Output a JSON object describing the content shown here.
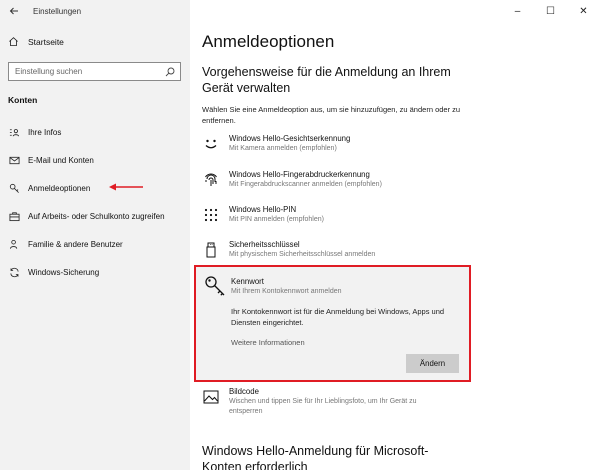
{
  "window": {
    "app_title": "Einstellungen",
    "back_icon": "back-arrow-icon",
    "controls": [
      "–",
      "☐",
      "✕"
    ]
  },
  "sidebar": {
    "home_label": "Startseite",
    "search_placeholder": "Einstellung suchen",
    "section_label": "Konten",
    "items": [
      {
        "label": "Ihre Infos",
        "icon": "person-card-icon"
      },
      {
        "label": "E-Mail und Konten",
        "icon": "mail-icon"
      },
      {
        "label": "Anmeldeoptionen",
        "icon": "key-icon",
        "selected": true
      },
      {
        "label": "Auf Arbeits- oder Schulkonto zugreifen",
        "icon": "briefcase-icon"
      },
      {
        "label": "Familie & andere Benutzer",
        "icon": "people-icon"
      },
      {
        "label": "Windows-Sicherung",
        "icon": "sync-icon"
      }
    ],
    "annotation_arrow_color": "#e01c24"
  },
  "main": {
    "title": "Anmeldeoptionen",
    "subtitle": "Vorgehensweise für die Anmeldung an Ihrem Gerät verwalten",
    "intro": "Wählen Sie eine Anmeldeoption aus, um sie hinzuzufügen, zu ändern oder zu entfernen.",
    "options": [
      {
        "title": "Windows Hello-Gesichtserkennung",
        "desc": "Mit Kamera anmelden (empfohlen)",
        "icon": "face-icon"
      },
      {
        "title": "Windows Hello-Fingerabdruckerkennung",
        "desc": "Mit Fingerabdruckscanner anmelden (empfohlen)",
        "icon": "fingerprint-icon"
      },
      {
        "title": "Windows Hello-PIN",
        "desc": "Mit PIN anmelden (empfohlen)",
        "icon": "pin-keypad-icon"
      },
      {
        "title": "Sicherheitsschlüssel",
        "desc": "Mit physischem Sicherheitsschlüssel anmelden",
        "icon": "usb-key-icon"
      }
    ],
    "kennwort": {
      "title": "Kennwort",
      "desc": "Mit Ihrem Kontokennwort anmelden",
      "info": "Ihr Kontokennwort ist für die Anmeldung bei Windows, Apps und Diensten eingerichtet.",
      "link": "Weitere Informationen",
      "button": "Ändern",
      "highlight_color": "#e01c24"
    },
    "bildcode": {
      "title": "Bildcode",
      "desc": "Wischen und tippen Sie für Ihr Lieblingsfoto, um Ihr Gerät zu entsperren"
    },
    "bottom_heading": "Windows Hello-Anmeldung für Microsoft-Konten erforderlich"
  }
}
